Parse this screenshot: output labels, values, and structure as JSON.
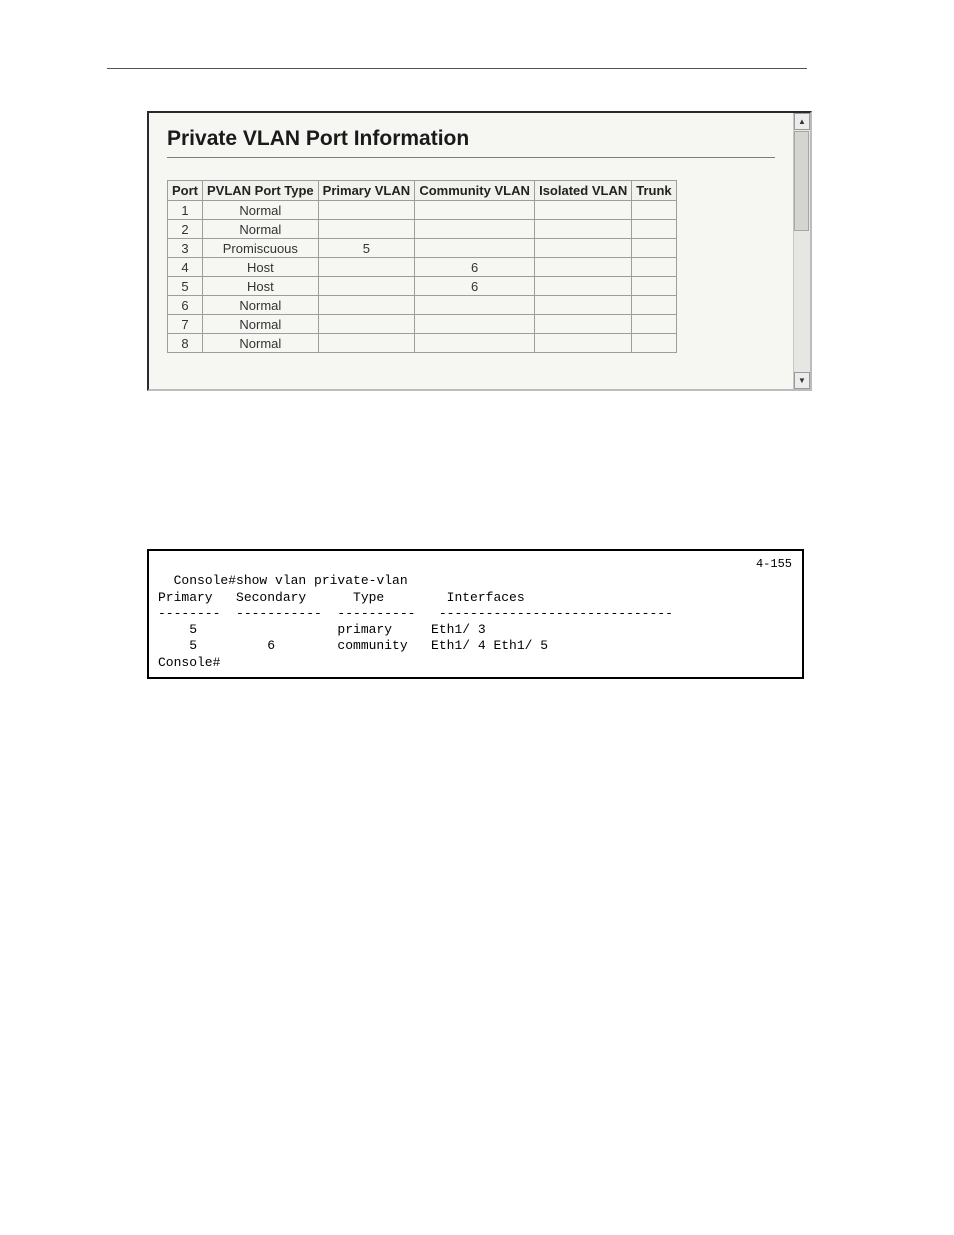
{
  "panel": {
    "title": "Private VLAN Port Information",
    "headers": [
      "Port",
      "PVLAN Port Type",
      "Primary VLAN",
      "Community VLAN",
      "Isolated VLAN",
      "Trunk"
    ],
    "rows": [
      {
        "port": "1",
        "type": "Normal",
        "primary": "",
        "community": "",
        "isolated": "",
        "trunk": ""
      },
      {
        "port": "2",
        "type": "Normal",
        "primary": "",
        "community": "",
        "isolated": "",
        "trunk": ""
      },
      {
        "port": "3",
        "type": "Promiscuous",
        "primary": "5",
        "community": "",
        "isolated": "",
        "trunk": ""
      },
      {
        "port": "4",
        "type": "Host",
        "primary": "",
        "community": "6",
        "isolated": "",
        "trunk": ""
      },
      {
        "port": "5",
        "type": "Host",
        "primary": "",
        "community": "6",
        "isolated": "",
        "trunk": ""
      },
      {
        "port": "6",
        "type": "Normal",
        "primary": "",
        "community": "",
        "isolated": "",
        "trunk": ""
      },
      {
        "port": "7",
        "type": "Normal",
        "primary": "",
        "community": "",
        "isolated": "",
        "trunk": ""
      },
      {
        "port": "8",
        "type": "Normal",
        "primary": "",
        "community": "",
        "isolated": "",
        "trunk": ""
      }
    ],
    "scroll_up_glyph": "▲",
    "scroll_down_glyph": "▼"
  },
  "cli": {
    "ref": "4-155",
    "text": "Console#show vlan private-vlan\nPrimary   Secondary      Type        Interfaces\n--------  -----------  ----------   ------------------------------\n    5                  primary     Eth1/ 3\n    5         6        community   Eth1/ 4 Eth1/ 5\nConsole#"
  }
}
